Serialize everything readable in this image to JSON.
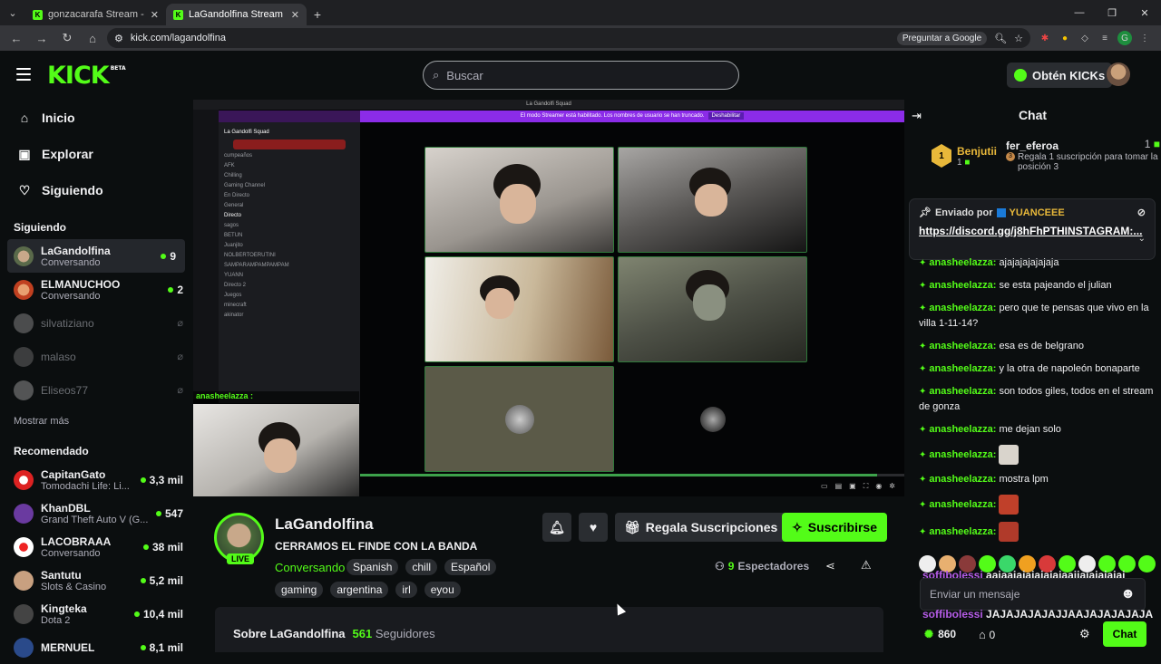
{
  "browser": {
    "tabs": [
      {
        "label": "gonzacarafa Stream - Watch Li..."
      },
      {
        "label": "LaGandolfina Stream - Watch Li..."
      }
    ],
    "url": "kick.com/lagandolfina",
    "google_pill": "Preguntar a Google"
  },
  "header": {
    "logo": "KICK",
    "logo_badge": "BETA",
    "search_placeholder": "Buscar",
    "get_kicks": "Obtén KICKs"
  },
  "sidebar": {
    "nav": [
      {
        "label": "Inicio",
        "icon": "home-icon"
      },
      {
        "label": "Explorar",
        "icon": "explore-icon"
      },
      {
        "label": "Siguiendo",
        "icon": "heart-icon"
      }
    ],
    "following_title": "Siguiendo",
    "following": [
      {
        "name": "LaGandolfina",
        "sub": "Conversando",
        "viewers": "9",
        "online": true
      },
      {
        "name": "ELMANUCHOO",
        "sub": "Conversando",
        "viewers": "2",
        "online": true
      },
      {
        "name": "silvatiziano",
        "online": false
      },
      {
        "name": "malaso",
        "online": false
      },
      {
        "name": "Eliseos77",
        "online": false
      }
    ],
    "show_more": "Mostrar más",
    "recommended_title": "Recomendado",
    "recommended": [
      {
        "name": "CapitanGato",
        "sub": "Tomodachi Life: Li...",
        "viewers": "3,3 mil"
      },
      {
        "name": "KhanDBL",
        "sub": "Grand Theft Auto V (G...",
        "viewers": "547"
      },
      {
        "name": "LACOBRAAA",
        "sub": "Conversando",
        "viewers": "38 mil"
      },
      {
        "name": "Santutu",
        "sub": "Slots & Casino",
        "viewers": "5,2 mil"
      },
      {
        "name": "Kingteka",
        "sub": "Dota 2",
        "viewers": "10,4 mil"
      },
      {
        "name": "MERNUEL",
        "sub": "",
        "viewers": "8,1 mil"
      }
    ]
  },
  "video": {
    "discord_title": "La Gandolfi Squad",
    "discord_banner": "El modo Streamer está habilitado. Los nombres de usuario se han truncado.",
    "discord_banner_btn": "Deshabilitar",
    "discord_server": "La Gandolfi Squad",
    "discord_channels": [
      "cumpeaños",
      "AFK",
      "Chilling",
      "Gaming Channel",
      "En Directo",
      "General",
      "Directo",
      "sagos",
      "BETUN",
      "Juanjito",
      "NOLBERTOERUTINI",
      "SAMPARAMPAMPAMPAM",
      "YUANN",
      "Directo 2",
      "Juegos",
      "minecraft",
      "akinator"
    ],
    "overlay_chat_user": "anasheelazza :"
  },
  "channel": {
    "name": "LaGandolfina",
    "live_badge": "LIVE",
    "title": "CERRAMOS EL FINDE CON LA BANDA",
    "category": "Conversando",
    "tags": [
      "Spanish",
      "chill",
      "Español",
      "gaming",
      "argentina",
      "irl",
      "eyou"
    ],
    "gift_label": "Regala Suscripciones",
    "subscribe_label": "Suscribirse",
    "viewers_count": "9",
    "viewers_label": "Espectadores",
    "about_title": "Sobre LaGandolfina",
    "followers_count": "561",
    "followers_label": "Seguidores"
  },
  "chat": {
    "title": "Chat",
    "top_gifter": {
      "rank": "1",
      "name": "Benjutii",
      "count": "1"
    },
    "second": {
      "name": "fer_eferoa",
      "count": "1",
      "rank": "3",
      "text": "Regala 1 suscripción para tomar la posición 3"
    },
    "pinned_by_label": "Enviado por",
    "pinned_by_user": "YUANCEEE",
    "pinned_text": "https://discord.gg/j8hFhPTHINSTAGRAM:...",
    "messages": [
      {
        "user": "anasheelazza:",
        "text": "ajajajajajajaja"
      },
      {
        "user": "anasheelazza:",
        "text": "se esta pajeando el julian"
      },
      {
        "user": "anasheelazza:",
        "text": "pero que te pensas que vivo en la villa 1-11-14?"
      },
      {
        "user": "anasheelazza:",
        "text": "esa es de belgrano"
      },
      {
        "user": "anasheelazza:",
        "text": "y la otra de napoleón bonaparte"
      },
      {
        "user": "anasheelazza:",
        "text": "son todos giles, todos en el stream de gonza"
      },
      {
        "user": "anasheelazza:",
        "text": "me dejan solo"
      },
      {
        "user": "anasheelazza:",
        "text": ""
      },
      {
        "user": "anasheelazza:",
        "text": "mostra lpm"
      },
      {
        "user": "anasheelazza:",
        "text": ""
      },
      {
        "user": "anasheelazza:",
        "text": ""
      }
    ],
    "soffi_user": "soffibolessi",
    "soffi_msg1": "aajaajajajajajajaajjajajajajaj",
    "soffi_msg2": "JAJAJAJAJAJJAAJAJAJAJAJA",
    "input_placeholder": "Enviar un mensaje",
    "kicks_count": "860",
    "store_count": "0",
    "chat_button": "Chat"
  }
}
